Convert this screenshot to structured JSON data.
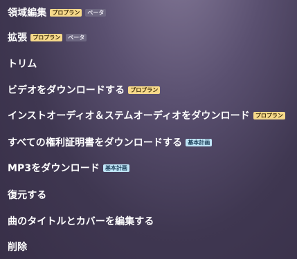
{
  "menu": {
    "items": [
      {
        "label": "領域編集",
        "badges": [
          "プロプラン",
          "ベータ"
        ]
      },
      {
        "label": "拡張",
        "badges": [
          "プロプラン",
          "ベータ"
        ]
      },
      {
        "label": "トリム",
        "badges": []
      },
      {
        "label": "ビデオをダウンロードする",
        "badges": [
          "プロプラン"
        ]
      },
      {
        "label": "インストオーディオ＆ステムオーディオをダウンロード",
        "badges": [
          "プロプラン"
        ]
      },
      {
        "label": "すべての権利証明書をダウンロードする",
        "badges": [
          "基本計画"
        ]
      },
      {
        "label": "MP3をダウンロード",
        "badges": [
          "基本計画"
        ]
      },
      {
        "label": "復元する",
        "badges": []
      },
      {
        "label": "曲のタイトルとカバーを編集する",
        "badges": []
      },
      {
        "label": "削除",
        "badges": []
      }
    ]
  },
  "colors": {
    "pro_badge": "#f6d98a",
    "beta_badge": "#6d6781",
    "basic_badge": "#bfe5f7"
  }
}
